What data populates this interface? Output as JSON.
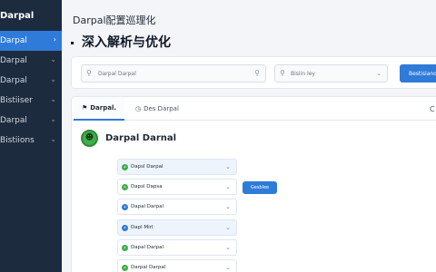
{
  "sidebar": {
    "title": "Darpal",
    "items": [
      {
        "label": "Darpal",
        "active": true
      },
      {
        "label": "Darpal"
      },
      {
        "label": "Darpal"
      },
      {
        "label": "Bistiiser"
      },
      {
        "label": "Darpal"
      },
      {
        "label": "Bistiions"
      }
    ]
  },
  "header": {
    "subtitle": "Darpal配置巡理化",
    "title": "深入解析与优化"
  },
  "search": {
    "placeholder": "Darpal Darpal",
    "select_placeholder": "Bisiin Iey",
    "button_label": "Bestisiano"
  },
  "tabs": [
    {
      "label": "Darpal.",
      "icon": "bookmark-icon",
      "active": true
    },
    {
      "label": "Des Darpal",
      "icon": "clock-icon"
    },
    {
      "label": "C",
      "icon": "more-icon"
    }
  ],
  "section": {
    "title": "Darpal Darnal",
    "avatar_icon": "smiley-icon"
  },
  "list": [
    {
      "label": "Dapsl Darpal",
      "dot_color": "#3fae4a"
    },
    {
      "label": "Dapsl Dapsa",
      "dot_color": "#3fae4a"
    },
    {
      "label": "Dapal Darpal",
      "dot_color": "#2f7bd9"
    },
    {
      "label": "Dapl Mirl",
      "dot_color": "#2f7bd9"
    },
    {
      "label": "Dapal Darpal",
      "dot_color": "#3fae4a"
    },
    {
      "label": "Darpal Darpal",
      "dot_color": "#3fae4a"
    }
  ],
  "action_button_label": "Gesblee",
  "colors": {
    "accent": "#2f7bd9",
    "sidebar": "#1d2b3e",
    "success": "#3fae4a"
  }
}
